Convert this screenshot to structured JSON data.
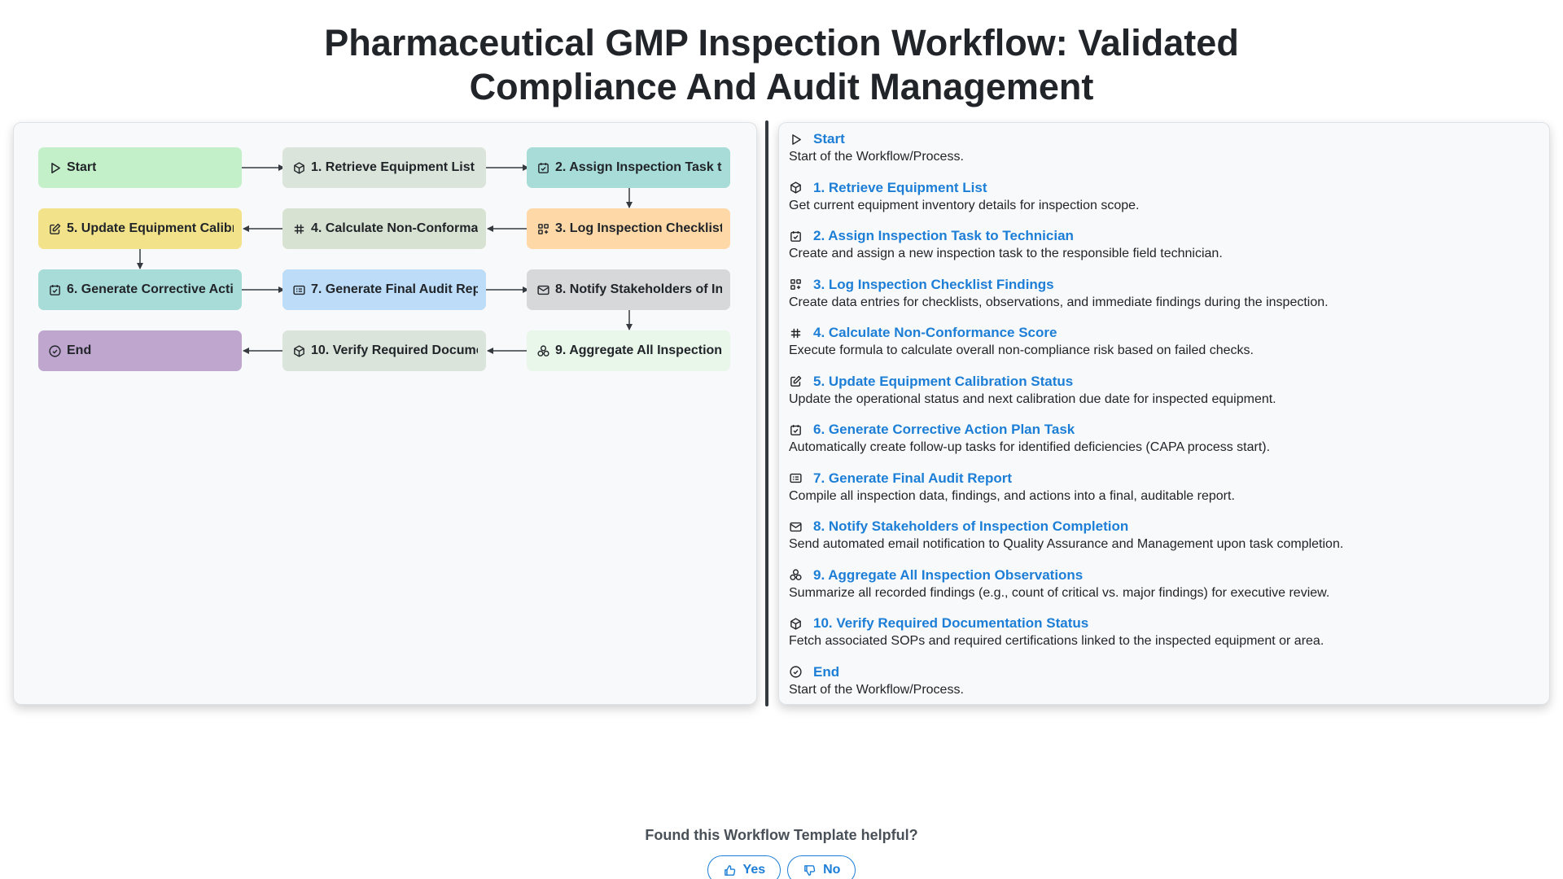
{
  "title": {
    "line1": "Pharmaceutical GMP Inspection Workflow: Validated",
    "line2": "Compliance And Audit Management"
  },
  "colors": {
    "link": "#1c7ed6",
    "start": "#c3f0c8",
    "retrieve": "#dbe4db",
    "assign": "#a8dcd9",
    "log": "#ffd8a8",
    "calculate": "#d8e2d2",
    "update": "#f2e28a",
    "corrective": "#a8dcd9",
    "report": "#bcdcf7",
    "notify": "#d6d8da",
    "aggregate": "#e9f6ea",
    "verify": "#dbe4db",
    "end": "#bea6cf"
  },
  "nodes": [
    {
      "id": "start",
      "label": "Start",
      "icon": "play-icon"
    },
    {
      "id": "retrieve",
      "label": "1. Retrieve Equipment List",
      "icon": "box-icon"
    },
    {
      "id": "assign",
      "label": "2. Assign Inspection Task t",
      "icon": "checkbox-icon"
    },
    {
      "id": "log",
      "label": "3. Log Inspection Checklist",
      "icon": "grid-plus-icon"
    },
    {
      "id": "calculate",
      "label": "4. Calculate Non-Conforma",
      "icon": "hash-icon"
    },
    {
      "id": "update",
      "label": "5. Update Equipment Calibr",
      "icon": "edit-icon"
    },
    {
      "id": "corrective",
      "label": "6. Generate Corrective Acti",
      "icon": "checkbox-icon"
    },
    {
      "id": "report",
      "label": "7. Generate Final Audit Rep",
      "icon": "report-icon"
    },
    {
      "id": "notify",
      "label": "8. Notify Stakeholders of In",
      "icon": "mail-icon"
    },
    {
      "id": "aggregate",
      "label": "9. Aggregate All Inspection",
      "icon": "circles-icon"
    },
    {
      "id": "verify",
      "label": "10. Verify Required Docume",
      "icon": "box-icon"
    },
    {
      "id": "end",
      "label": "End",
      "icon": "check-circle-icon"
    }
  ],
  "steps": [
    {
      "title": "Start",
      "desc": "Start of the Workflow/Process.",
      "icon": "play-icon"
    },
    {
      "title": "1. Retrieve Equipment List",
      "desc": "Get current equipment inventory details for inspection scope.",
      "icon": "box-icon"
    },
    {
      "title": "2. Assign Inspection Task to Technician",
      "desc": "Create and assign a new inspection task to the responsible field technician.",
      "icon": "checkbox-icon"
    },
    {
      "title": "3. Log Inspection Checklist Findings",
      "desc": "Create data entries for checklists, observations, and immediate findings during the inspection.",
      "icon": "grid-plus-icon"
    },
    {
      "title": "4. Calculate Non-Conformance Score",
      "desc": "Execute formula to calculate overall non-compliance risk based on failed checks.",
      "icon": "hash-icon"
    },
    {
      "title": "5. Update Equipment Calibration Status",
      "desc": "Update the operational status and next calibration due date for inspected equipment.",
      "icon": "edit-icon"
    },
    {
      "title": "6. Generate Corrective Action Plan Task",
      "desc": "Automatically create follow-up tasks for identified deficiencies (CAPA process start).",
      "icon": "checkbox-icon"
    },
    {
      "title": "7. Generate Final Audit Report",
      "desc": "Compile all inspection data, findings, and actions into a final, auditable report.",
      "icon": "report-icon"
    },
    {
      "title": "8. Notify Stakeholders of Inspection Completion",
      "desc": "Send automated email notification to Quality Assurance and Management upon task completion.",
      "icon": "mail-icon"
    },
    {
      "title": "9. Aggregate All Inspection Observations",
      "desc": "Summarize all recorded findings (e.g., count of critical vs. major findings) for executive review.",
      "icon": "circles-icon"
    },
    {
      "title": "10. Verify Required Documentation Status",
      "desc": "Fetch associated SOPs and required certifications linked to the inspected equipment or area.",
      "icon": "box-icon"
    },
    {
      "title": "End",
      "desc": "Start of the Workflow/Process.",
      "icon": "check-circle-icon"
    }
  ],
  "feedback": {
    "question": "Found this Workflow Template helpful?",
    "yes_label": "Yes",
    "no_label": "No"
  }
}
